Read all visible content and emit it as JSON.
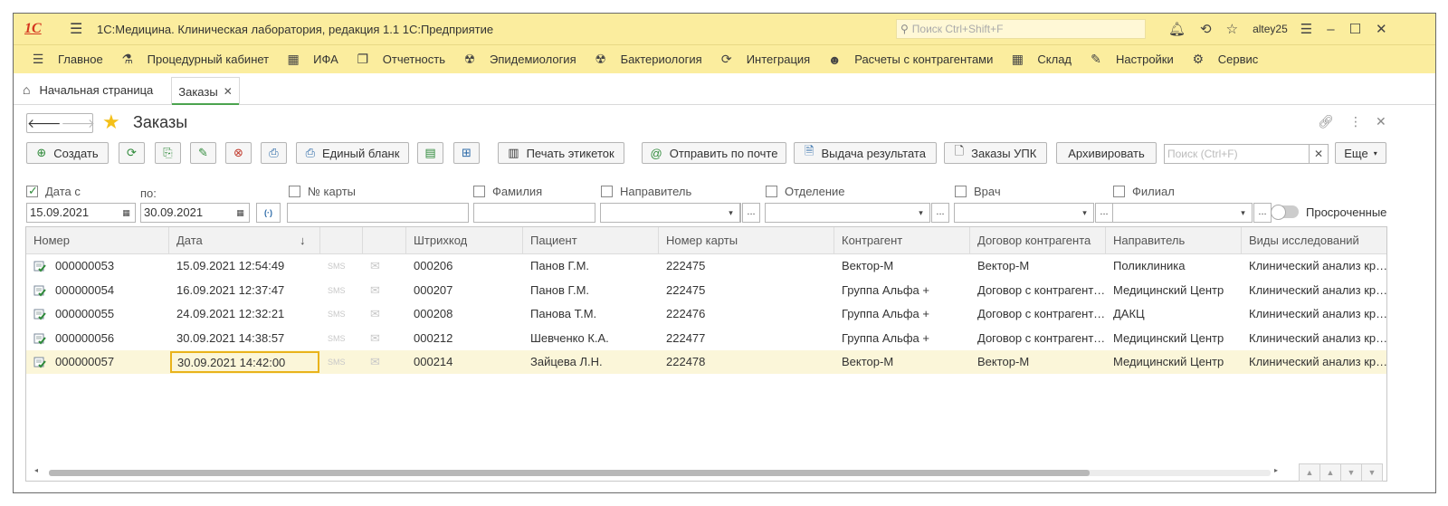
{
  "app": {
    "logo": "1С",
    "title": "1С:Медицина. Клиническая лаборатория, редакция 1.1 1С:Предприятие",
    "search_placeholder": "Поиск Ctrl+Shift+F",
    "user": "altey25"
  },
  "sections": [
    {
      "label": "Главное",
      "icon": "hamburger-icon",
      "glyph": "☰"
    },
    {
      "label": "Процедурный кабинет",
      "icon": "test-tube-icon",
      "glyph": "⚗"
    },
    {
      "label": "ИФА",
      "icon": "grid-plate-icon",
      "glyph": "▦"
    },
    {
      "label": "Отчетность",
      "icon": "documents-icon",
      "glyph": "❐"
    },
    {
      "label": "Эпидемиология",
      "icon": "virus-icon",
      "glyph": "☢"
    },
    {
      "label": "Бактериология",
      "icon": "bacteria-icon",
      "glyph": "☢"
    },
    {
      "label": "Интеграция",
      "icon": "sync-icon",
      "glyph": "⟳"
    },
    {
      "label": "Расчеты с контрагентами",
      "icon": "people-icon",
      "glyph": "☻"
    },
    {
      "label": "Склад",
      "icon": "warehouse-icon",
      "glyph": "▦"
    },
    {
      "label": "Настройки",
      "icon": "wrench-icon",
      "glyph": "✎"
    },
    {
      "label": "Сервис",
      "icon": "gear-icon",
      "glyph": "⚙"
    }
  ],
  "tabs": {
    "home": "Начальная страница",
    "active": "Заказы"
  },
  "form": {
    "title": "Заказы"
  },
  "toolbar": {
    "create": "Создать",
    "blank": "Единый бланк",
    "print_labels": "Печать этикеток",
    "send_mail": "Отправить по почте",
    "issue_result": "Выдача результата",
    "upk_orders": "Заказы УПК",
    "archive": "Архивировать",
    "search_placeholder": "Поиск (Ctrl+F)",
    "more": "Еще"
  },
  "filters": {
    "date_from_label": "Дата с",
    "date_from_checked": true,
    "date_from": "15.09.2021",
    "date_to_label": "по:",
    "date_to": "30.09.2021",
    "card_label": "№ карты",
    "surname_label": "Фамилия",
    "referrer_label": "Направитель",
    "department_label": "Отделение",
    "doctor_label": "Врач",
    "branch_label": "Филиал",
    "overdue_label": "Просроченные"
  },
  "table": {
    "columns": [
      "Номер",
      "Дата",
      "",
      "",
      "Штрихкод",
      "Пациент",
      "Номер карты",
      "Контрагент",
      "Договор контрагента",
      "Направитель",
      "Виды исследований"
    ],
    "sort_indicator": "↓",
    "sms_label": "SMS",
    "rows": [
      {
        "number": "000000053",
        "date": "15.09.2021 12:54:49",
        "barcode": "000206",
        "patient": "Панов Г.М.",
        "card": "222475",
        "contractor": "Вектор-М",
        "contract": "Вектор-М",
        "referrer": "Поликлиника",
        "research": "Клинический анализ крови"
      },
      {
        "number": "000000054",
        "date": "16.09.2021 12:37:47",
        "barcode": "000207",
        "patient": "Панов Г.М.",
        "card": "222475",
        "contractor": "Группа Альфа +",
        "contract": "Договор с контрагентом",
        "referrer": "Медицинский Центр",
        "research": "Клинический анализ крови"
      },
      {
        "number": "000000055",
        "date": "24.09.2021 12:32:21",
        "barcode": "000208",
        "patient": "Панова Т.М.",
        "card": "222476",
        "contractor": "Группа Альфа +",
        "contract": "Договор с контрагентом",
        "referrer": "ДАКЦ",
        "research": "Клинический анализ крови"
      },
      {
        "number": "000000056",
        "date": "30.09.2021 14:38:57",
        "barcode": "000212",
        "patient": "Шевченко К.А.",
        "card": "222477",
        "contractor": "Группа Альфа +",
        "contract": "Договор с контрагентом",
        "referrer": "Медицинский Центр",
        "research": "Клинический анализ крови"
      },
      {
        "number": "000000057",
        "date": "30.09.2021 14:42:00",
        "barcode": "000214",
        "patient": "Зайцева Л.Н.",
        "card": "222478",
        "contractor": "Вектор-М",
        "contract": "Вектор-М",
        "referrer": "Медицинский Центр",
        "research": "Клинический анализ крови"
      }
    ],
    "selected_row": 4
  },
  "colors": {
    "header_bg": "#fbed9e",
    "accent_green": "#4ba34f",
    "selected_cell_border": "#e9b31b"
  }
}
